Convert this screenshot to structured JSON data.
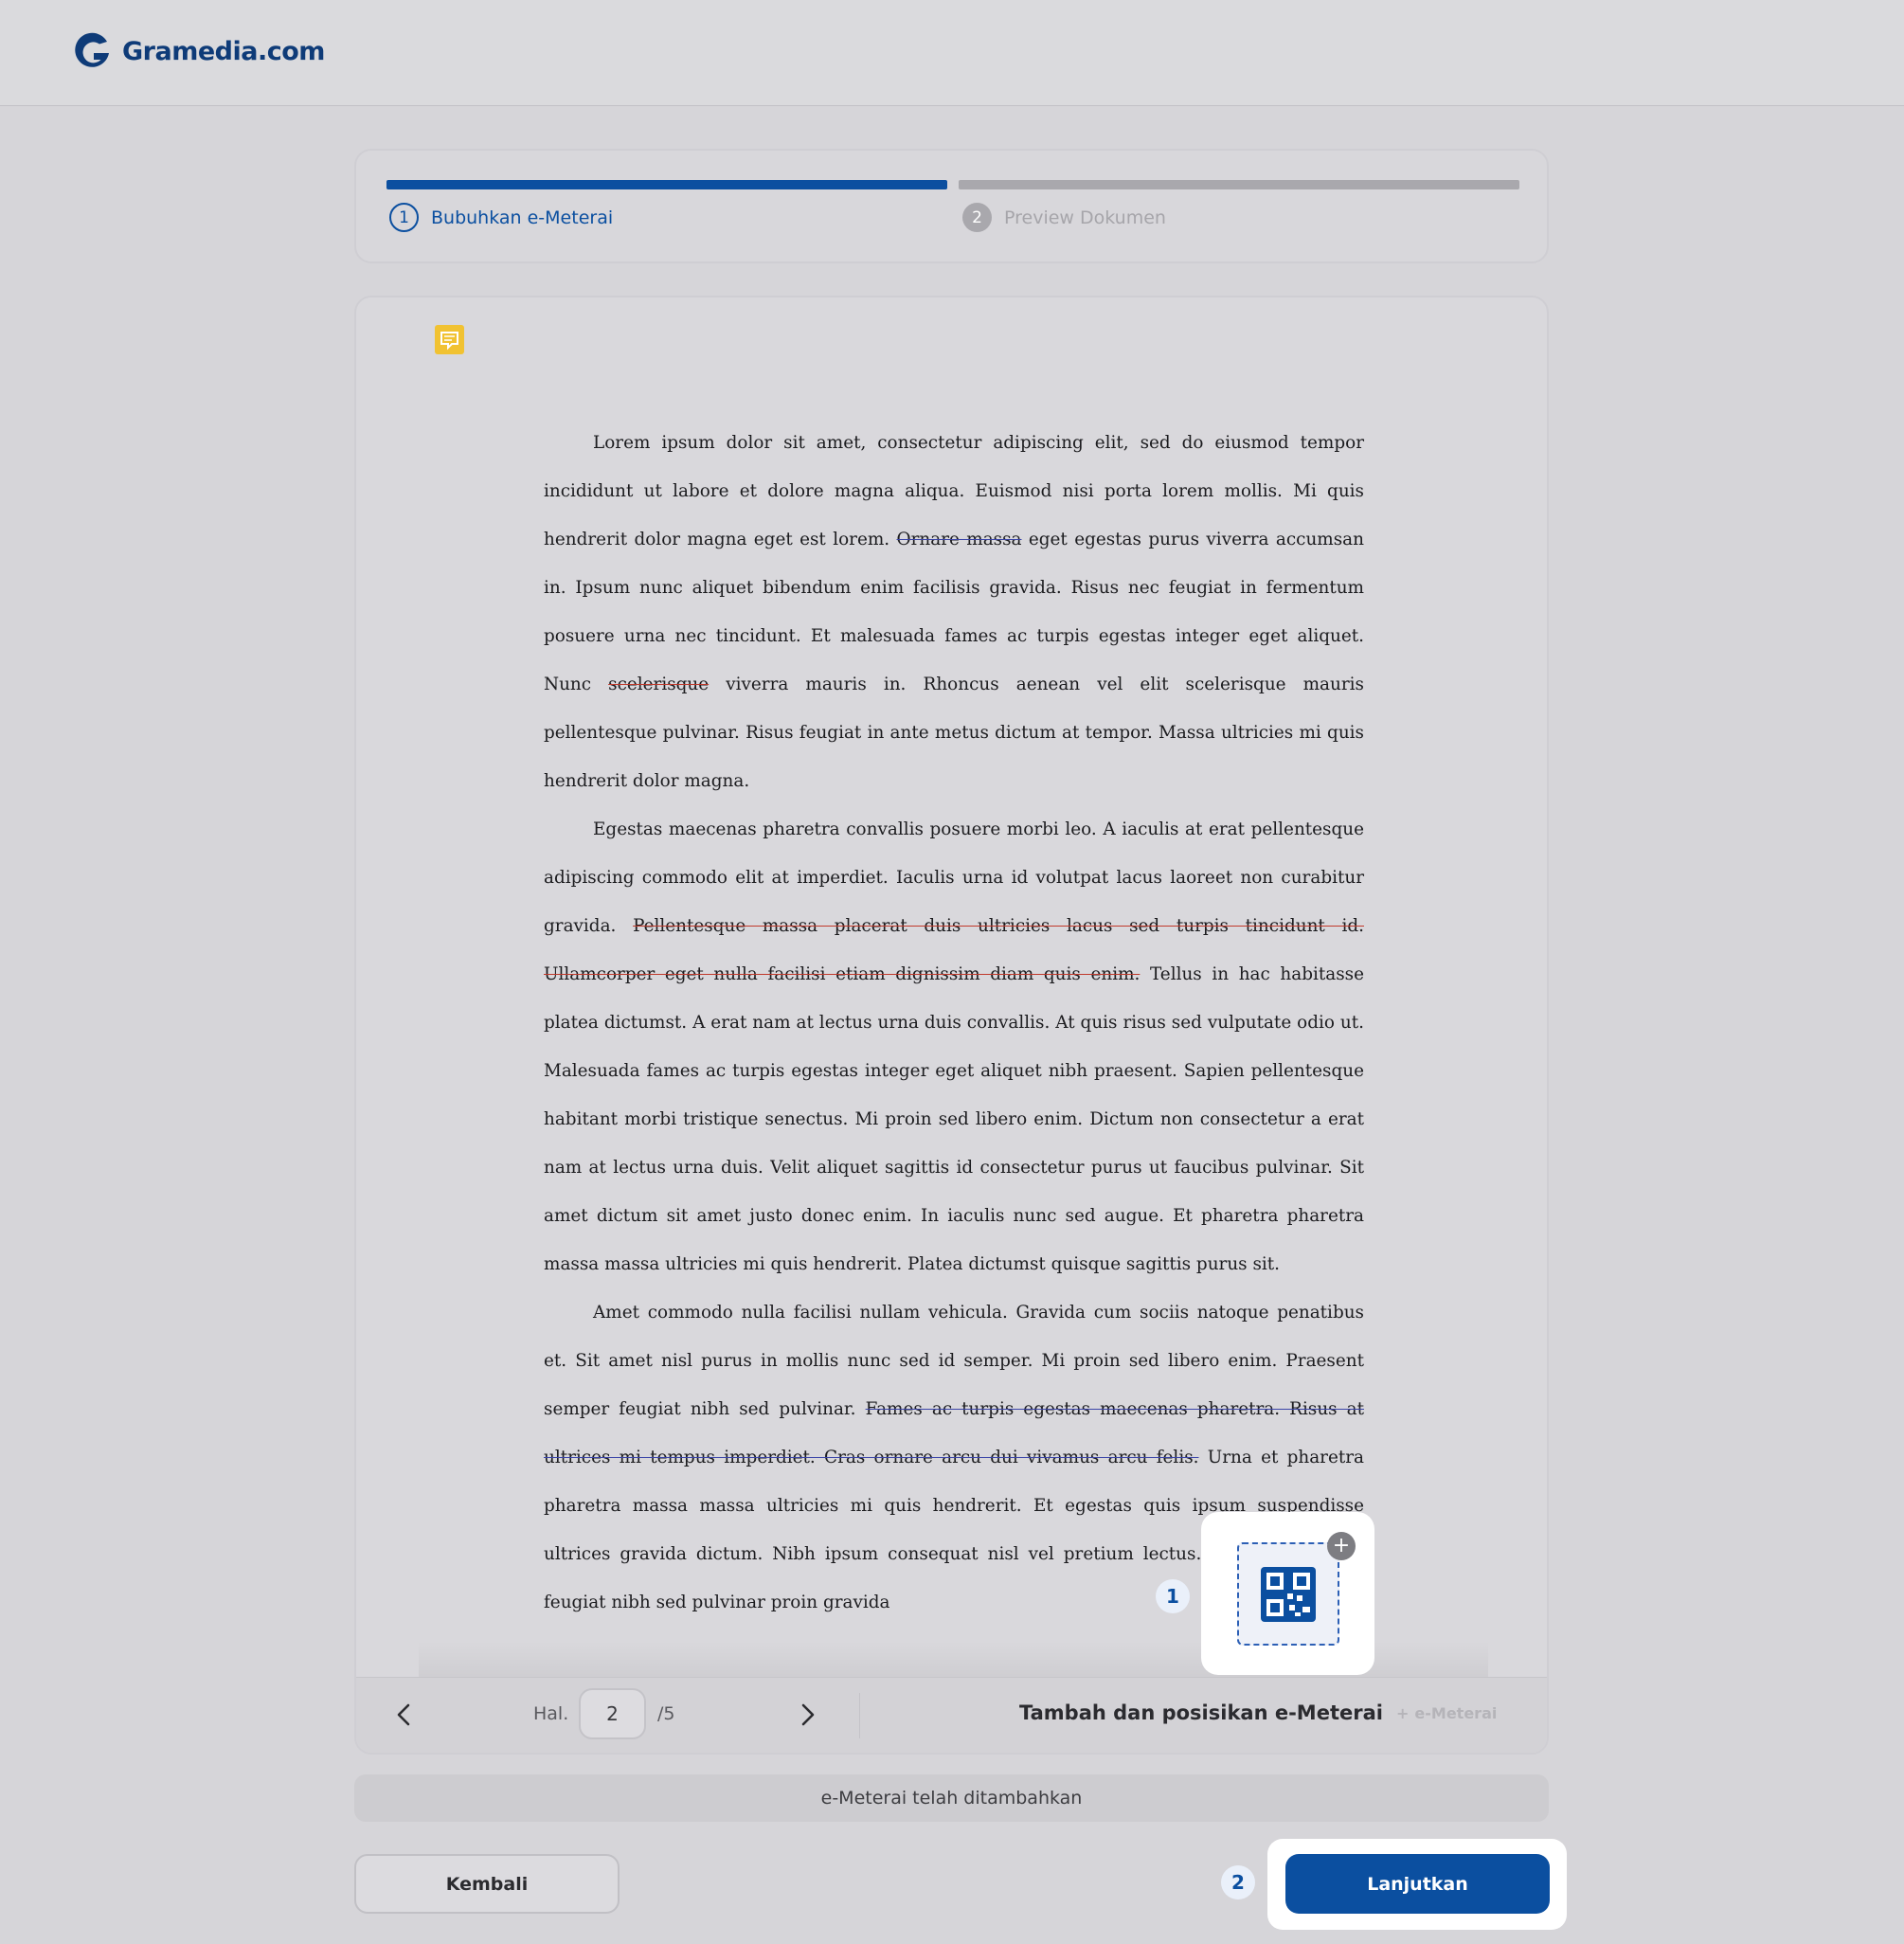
{
  "header": {
    "logo_text": "Gramedia.com"
  },
  "stepper": {
    "steps": [
      {
        "number": "1",
        "label": "Bubuhkan e-Meterai",
        "active": true
      },
      {
        "number": "2",
        "label": "Preview Dokumen",
        "active": false
      }
    ]
  },
  "document": {
    "paragraphs": [
      {
        "segments": [
          {
            "text": "Lorem ipsum dolor sit amet, consectetur adipiscing elit, sed do eiusmod tempor incididunt ut labore et dolore magna aliqua. Euismod nisi porta lorem mollis. Mi quis hendrerit dolor magna eget est lorem. "
          },
          {
            "text": "Ornare massa",
            "struck": true
          },
          {
            "text": " eget egestas purus viverra accumsan in. Ipsum nunc aliquet bibendum enim facilisis gravida. Risus nec feugiat in fermentum posuere urna nec tincidunt. Et malesuada fames ac turpis egestas integer eget aliquet. Nunc "
          },
          {
            "text": "scelerisque",
            "struck": true
          },
          {
            "text": " viverra mauris in. Rhoncus aenean vel elit scelerisque mauris pellentesque pulvinar. Risus feugiat in ante metus dictum at tempor. Massa ultricies mi quis hendrerit dolor magna."
          }
        ]
      },
      {
        "segments": [
          {
            "text": "Egestas maecenas pharetra convallis posuere morbi leo. A iaculis at erat pellentesque adipiscing commodo elit at imperdiet. Iaculis urna id volutpat lacus laoreet non curabitur gravida. "
          },
          {
            "text": "Pellentesque massa placerat duis ultricies lacus sed turpis tincidunt id. Ullamcorper eget nulla facilisi etiam dignissim diam quis enim.",
            "struck": true
          },
          {
            "text": " Tellus in hac habitasse platea dictumst. A erat nam at lectus urna duis convallis. At quis risus sed vulputate odio ut. Malesuada fames ac turpis egestas integer eget aliquet nibh praesent. Sapien pellentesque habitant morbi tristique senectus. Mi proin sed libero enim. Dictum non consectetur a erat nam at lectus urna duis. Velit aliquet sagittis id consectetur purus ut faucibus pulvinar. Sit amet dictum sit amet justo donec enim. In iaculis nunc sed augue. Et pharetra pharetra massa massa ultricies mi quis hendrerit. Platea dictumst quisque sagittis purus sit."
          }
        ]
      },
      {
        "segments": [
          {
            "text": "Amet commodo nulla facilisi nullam vehicula. Gravida cum sociis natoque penatibus et. Sit amet nisl purus in mollis nunc sed id semper. Mi proin sed libero enim. Praesent semper feugiat nibh sed pulvinar. "
          },
          {
            "text": "Fames ac turpis egestas maecenas pharetra. Risus at ultrices mi tempus imperdiet. Cras ornare arcu dui vivamus arcu felis.",
            "struck": true
          },
          {
            "text": " Urna et pharetra pharetra massa massa ultricies mi quis hendrerit. Et egestas quis ipsum suspendisse ultrices gravida dictum. Nibh ipsum consequat nisl vel pretium lectus. Praesent semper feugiat nibh sed pulvinar proin gravida"
          }
        ]
      }
    ],
    "stamp_icon": "qr-code-icon"
  },
  "pager": {
    "hal_label": "Hal.",
    "current_page": "2",
    "total": "/5",
    "title": "Tambah dan posisikan e-Meterai",
    "add_label": "e-Meterai"
  },
  "markers": {
    "one": "1",
    "two": "2"
  },
  "status_text": "e-Meterai telah ditambahkan",
  "actions": {
    "back_label": "Kembali",
    "next_label": "Lanjutkan"
  },
  "colors": {
    "brand_blue": "#0b4fa0",
    "background": "#d6d5d9",
    "strike_red": "#c0392b",
    "strike_blue": "#3b45a8"
  }
}
